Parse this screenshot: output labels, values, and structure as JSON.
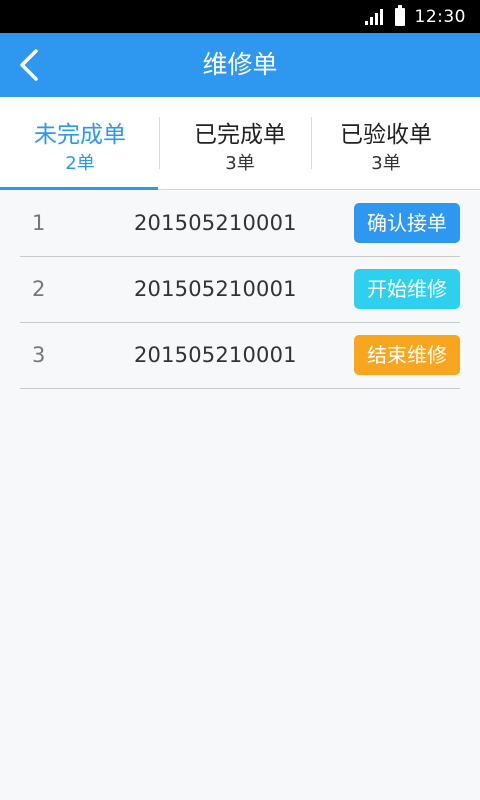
{
  "status_bar": {
    "time": "12:30"
  },
  "header": {
    "title": "维修单"
  },
  "tabs": [
    {
      "label": "未完成单",
      "count": "2单",
      "active": true
    },
    {
      "label": "已完成单",
      "count": "3单",
      "active": false
    },
    {
      "label": "已验收单",
      "count": "3单",
      "active": false
    }
  ],
  "orders": [
    {
      "index": "1",
      "number": "201505210001",
      "action": "确认接单",
      "color": "#2e97f0"
    },
    {
      "index": "2",
      "number": "201505210001",
      "action": "开始维修",
      "color": "#2fd0ee"
    },
    {
      "index": "3",
      "number": "201505210001",
      "action": "结束维修",
      "color": "#f8a51f"
    }
  ],
  "colors": {
    "accent": "#2e97f0",
    "background": "#f7f8fa"
  }
}
